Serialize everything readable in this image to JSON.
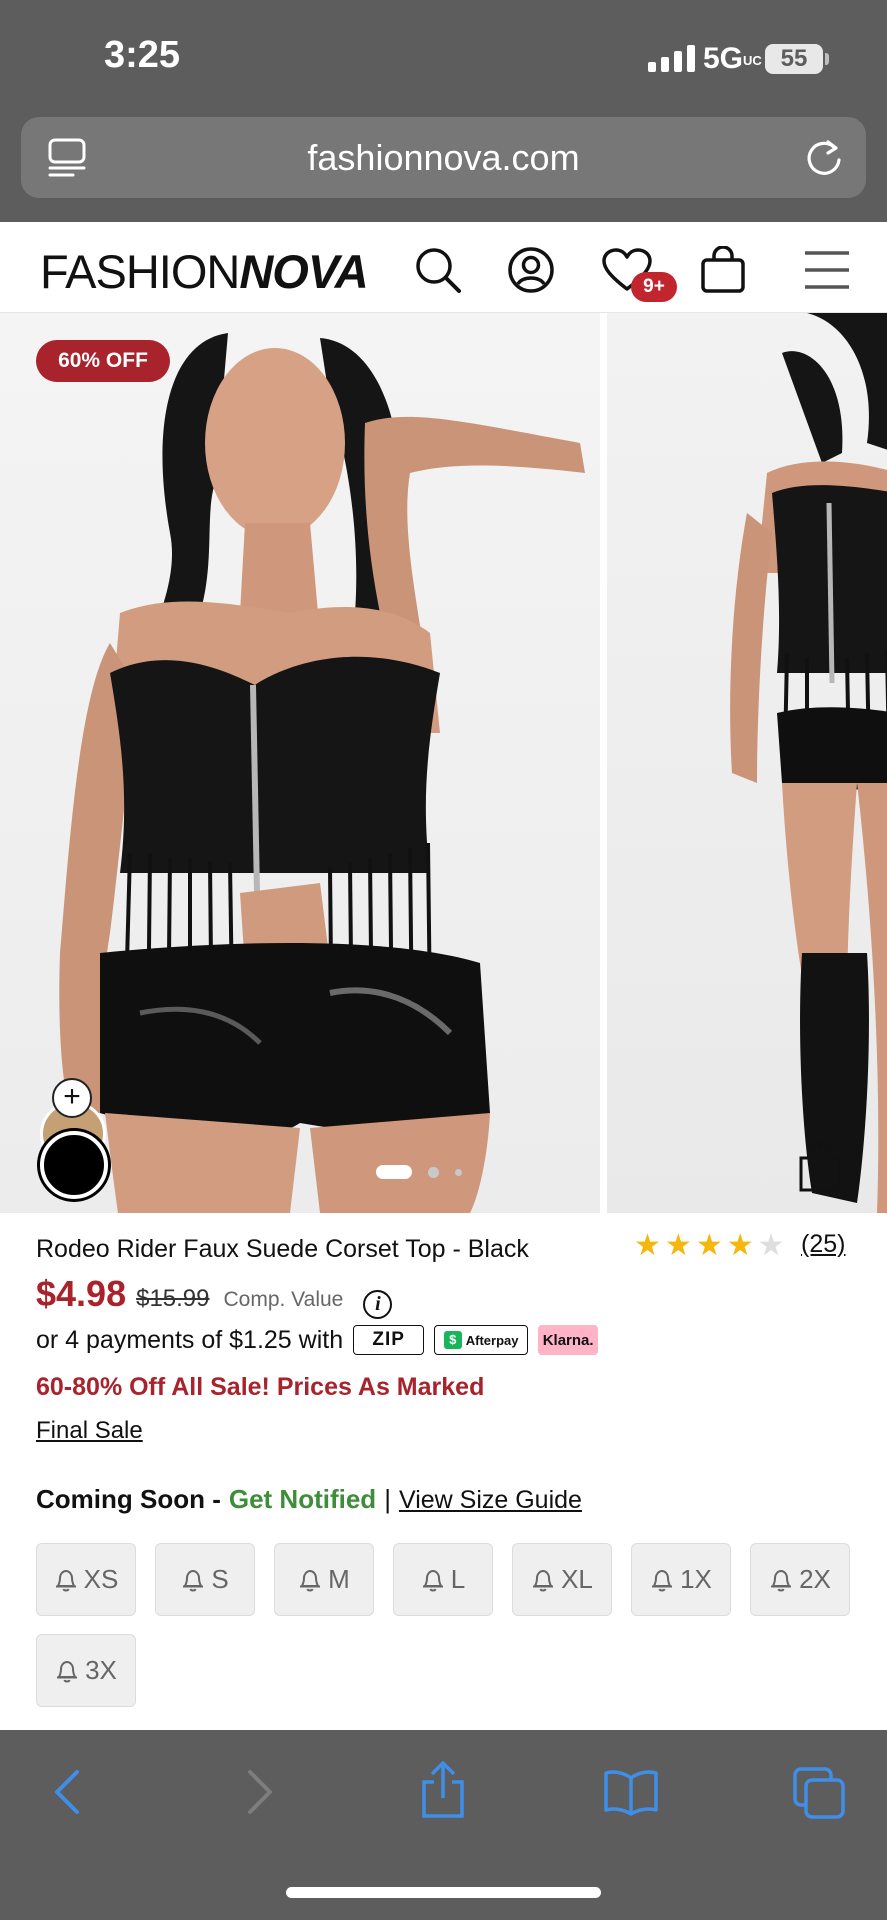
{
  "status_bar": {
    "time": "3:25",
    "network": "5G",
    "network_suffix": "UC",
    "battery": "55"
  },
  "browser": {
    "url": "fashionnova.com"
  },
  "site_header": {
    "logo_light": "FASHION",
    "logo_bold": "NOVA",
    "wishlist_badge": "9+"
  },
  "gallery": {
    "sale_badge": "60% OFF",
    "slide_count": 3,
    "active_slide": 1,
    "swatch_add": "+"
  },
  "product": {
    "title": "Rodeo Rider Faux Suede Corset Top - Black",
    "rating": 4,
    "rating_max": 5,
    "review_count": "(25)",
    "price": "$4.98",
    "original_price": "$15.99",
    "comp_value_label": "Comp. Value",
    "info_glyph": "i",
    "installments_text": "or 4 payments of $1.25 with",
    "payment_providers": {
      "zip": "ZIP",
      "afterpay": "Afterpay",
      "klarna": "Klarna."
    },
    "promo": "60-80% Off All Sale! Prices As Marked",
    "final_sale": "Final Sale",
    "availability": "Coming Soon -",
    "get_notified": "Get Notified",
    "separator": "|",
    "size_guide": "View Size Guide",
    "sizes": [
      "XS",
      "S",
      "M",
      "L",
      "XL",
      "1X",
      "2X",
      "3X"
    ]
  },
  "colors": {
    "sale_red": "#a8232b",
    "notify_green": "#3e8d3a",
    "browser_chrome": "#5d5d5d",
    "ios_blue": "#3f8fe8",
    "star_gold": "#f5b70c"
  }
}
